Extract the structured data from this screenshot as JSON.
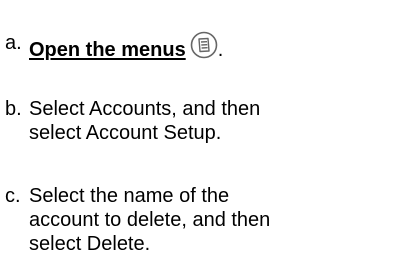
{
  "steps": [
    {
      "letter": "a.",
      "link_text": "Open the menus",
      "icon": "menu-icon",
      "trailing": "."
    },
    {
      "letter": "b.",
      "lines": [
        "Select Accounts, and then",
        "select Account Setup."
      ]
    },
    {
      "letter": "c.",
      "lines": [
        "Select the name of the",
        "account to delete, and then",
        "select Delete."
      ]
    }
  ],
  "colors": {
    "text": "#000000",
    "icon_stroke": "#666666",
    "background": "#ffffff"
  }
}
